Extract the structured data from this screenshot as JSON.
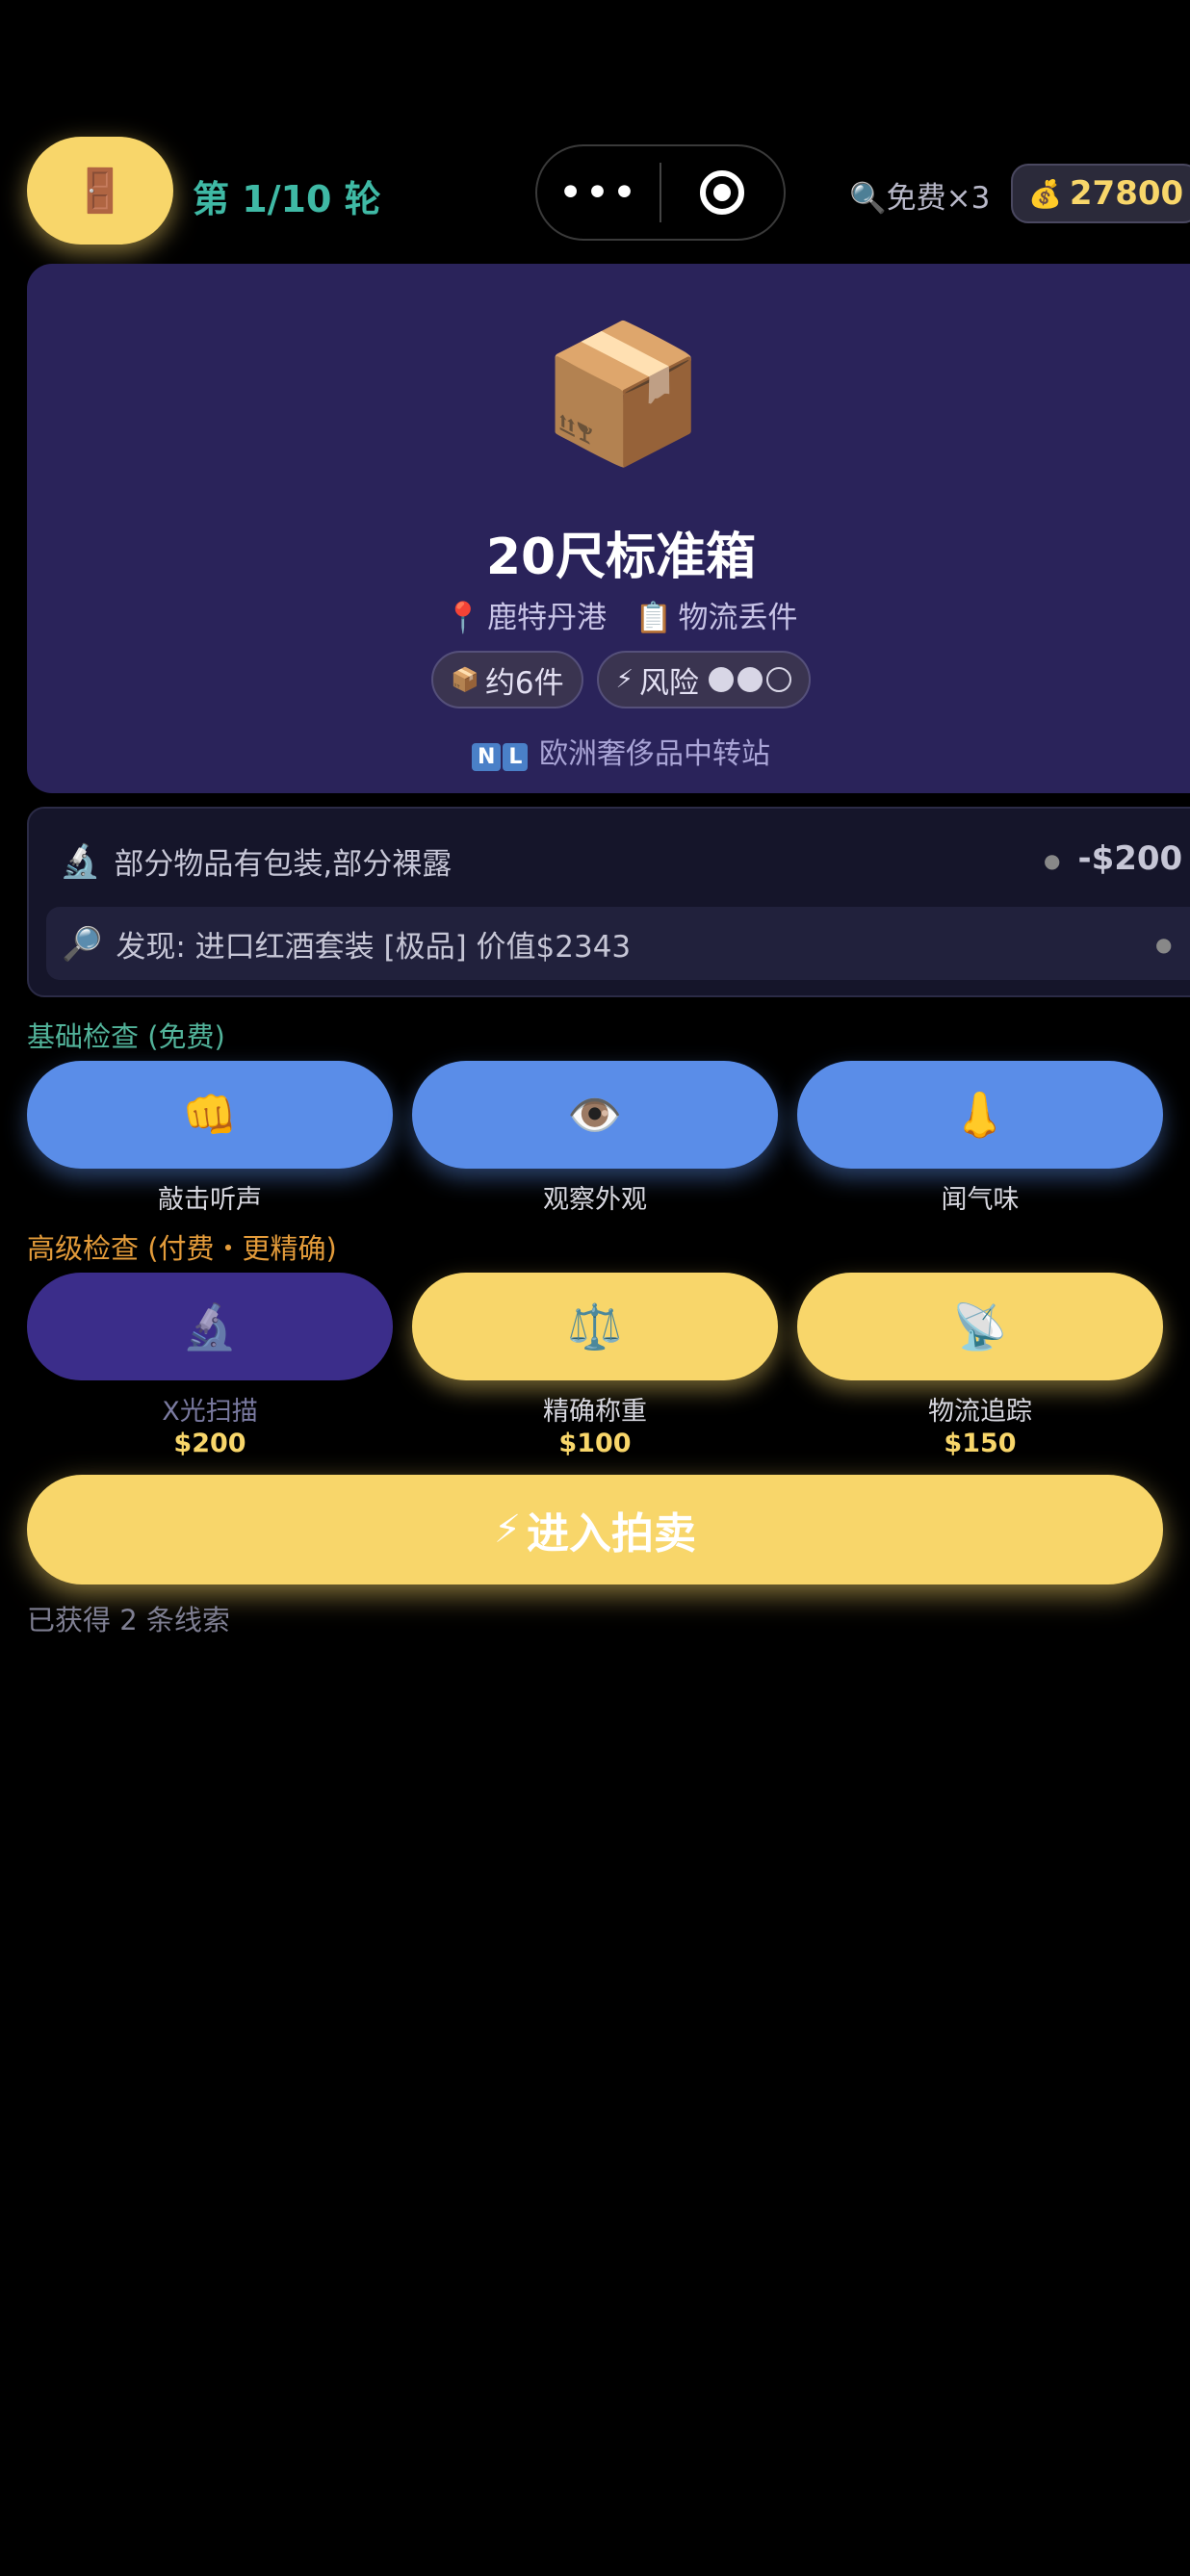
{
  "header": {
    "exit_icon": "🚪",
    "round_label": "第 1/10 轮",
    "menu_dots": "•••",
    "free_icon": "🔍",
    "free_label": "免费×3",
    "money_icon": "💰",
    "money": "27800"
  },
  "container": {
    "emoji": "📦",
    "title": "20尺标准箱",
    "location_icon": "📍",
    "location": "鹿特丹港",
    "source_icon": "📋",
    "source": "物流丢件",
    "count_icon": "📦",
    "count_label": "约6件",
    "risk_icon": "⚡",
    "risk_label": "风险",
    "risk_level": 2,
    "risk_max": 3,
    "flag_letters": [
      "N",
      "L"
    ],
    "origin": "欧洲奢侈品中转站"
  },
  "clues": [
    {
      "icon": "🔬",
      "text": "部分物品有包装,部分裸露",
      "cost": "-$200"
    },
    {
      "icon": "🔎",
      "text": "发现: 进口红酒套装 [极品] 价值$2343"
    }
  ],
  "basic_section": {
    "title": "基础检查 (免费)",
    "tools": [
      {
        "icon": "👊",
        "label": "敲击听声"
      },
      {
        "icon": "👁️",
        "label": "观察外观"
      },
      {
        "icon": "👃",
        "label": "闻气味"
      }
    ]
  },
  "advanced_section": {
    "title": "高级检查 (付费・更精确)",
    "tools": [
      {
        "icon": "🔬",
        "label": "X光扫描",
        "price": "$200",
        "used": true
      },
      {
        "icon": "⚖️",
        "label": "精确称重",
        "price": "$100",
        "used": false
      },
      {
        "icon": "📡",
        "label": "物流追踪",
        "price": "$150",
        "used": false
      }
    ]
  },
  "auction_button": {
    "icon": "⚡",
    "label": "进入拍卖"
  },
  "clue_count": "已获得 2 条线索",
  "colors": {
    "accent_yellow": "#f8d66a",
    "tool_blue": "#5a8de8",
    "card_purple": "#2a235a",
    "round_teal": "#3fb9a5"
  }
}
